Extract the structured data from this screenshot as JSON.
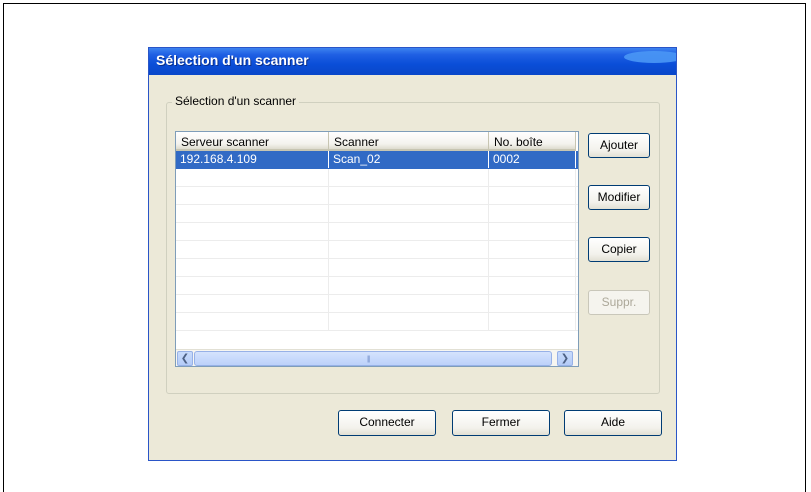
{
  "dialog": {
    "title": "Sélection d'un scanner",
    "group_label": "Sélection d'un scanner"
  },
  "list": {
    "columns": [
      "Serveur scanner",
      "Scanner",
      "No. boîte"
    ],
    "rows": [
      [
        "192.168.4.109",
        "Scan_02",
        "0002"
      ]
    ],
    "selected_row": 0,
    "empty_rows": 9
  },
  "side_buttons": {
    "add": "Ajouter",
    "edit": "Modifier",
    "copy": "Copier",
    "delete": "Suppr."
  },
  "bottom_buttons": {
    "connect": "Connecter",
    "close": "Fermer",
    "help": "Aide"
  },
  "icons": {
    "scroll_left": "chevron-left-icon",
    "scroll_right": "chevron-right-icon"
  },
  "colors": {
    "title_bar": "#0a4ed8",
    "selection": "#316ac5",
    "dialog_bg": "#ece9d8"
  }
}
